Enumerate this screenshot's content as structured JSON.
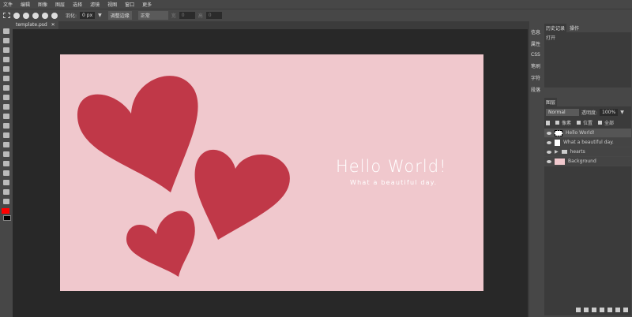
{
  "menu": [
    "文件",
    "编辑",
    "图像",
    "图层",
    "选择",
    "滤镜",
    "视图",
    "窗口",
    "更多"
  ],
  "options": {
    "feather_label": "羽化:",
    "feather_value": "0 px",
    "refine_button": "调整边缘",
    "style_select": "正常",
    "width_label": "宽",
    "width_value": "0",
    "height_label": "高",
    "height_value": "0"
  },
  "document_tab": {
    "title": "template.psd",
    "close": "✕"
  },
  "canvas": {
    "background": "#f0c8cd",
    "heart_color": "#c03848",
    "title": "Hello World!",
    "subtitle": "What a beautiful day."
  },
  "side_tabs": [
    "信息",
    "属性",
    "CSS",
    "笔刷",
    "字符",
    "段落"
  ],
  "history": {
    "tabs": [
      "历史记录",
      "操作"
    ],
    "items": [
      "打开"
    ]
  },
  "layers": {
    "tab": "图层",
    "blend_mode": "Normal",
    "opacity_label": "透明度:",
    "opacity_value": "100%",
    "lock_label": "锁定:",
    "lock_options": [
      "像素",
      "位置",
      "全部"
    ],
    "items": [
      {
        "name": "Hello World!"
      },
      {
        "name": "What a beautiful day."
      },
      {
        "name": "hearts"
      },
      {
        "name": "Background"
      }
    ]
  },
  "colors": {
    "foreground": "#ff0000",
    "background": "#000000"
  }
}
